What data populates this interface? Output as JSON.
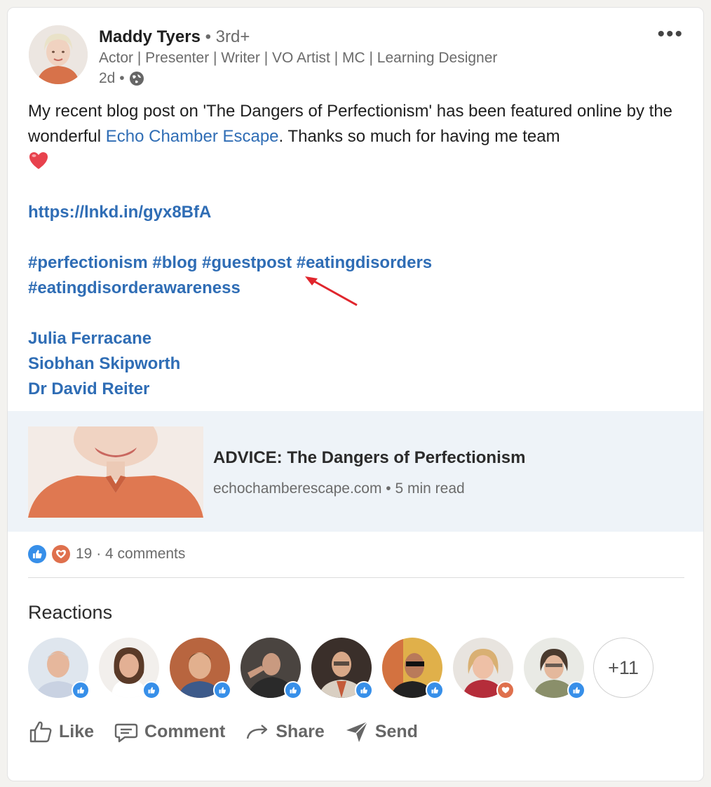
{
  "post": {
    "author": {
      "name": "Maddy Tyers",
      "degree": "• 3rd+",
      "headline": "Actor | Presenter | Writer | VO Artist | MC | Learning Designer",
      "time": "2d •"
    },
    "text_part1": "My recent blog post on 'The Dangers of Perfectionism' has been featured online by the wonderful ",
    "mention": "Echo Chamber Escape",
    "text_part2": ". Thanks so much for having me team",
    "short_link": "https://lnkd.in/gyx8BfA",
    "hashtags_line1": "#perfectionism #blog #guestpost #eatingdisorders",
    "hashtags_line2": "#eatingdisorderawareness",
    "tagged_people": [
      "Julia Ferracane",
      "Siobhan Skipworth",
      "Dr David Reiter"
    ]
  },
  "preview": {
    "title": "ADVICE: The Dangers of Perfectionism",
    "meta": "echochamberescape.com • 5 min read"
  },
  "social": {
    "counts": "19 · 4 comments"
  },
  "reactions": {
    "title": "Reactions",
    "more_count": "+11",
    "people": [
      {
        "reaction": "like-icon"
      },
      {
        "reaction": "like-icon"
      },
      {
        "reaction": "like-icon"
      },
      {
        "reaction": "like-icon"
      },
      {
        "reaction": "like-icon"
      },
      {
        "reaction": "like-icon"
      },
      {
        "reaction": "love-icon"
      },
      {
        "reaction": "like-icon"
      }
    ]
  },
  "actions": {
    "like": "Like",
    "comment": "Comment",
    "share": "Share",
    "send": "Send"
  },
  "colors": {
    "link": "#2f6db5",
    "like_badge": "#378fe9",
    "love_badge": "#df704d",
    "preview_bg": "#eef3f8"
  }
}
